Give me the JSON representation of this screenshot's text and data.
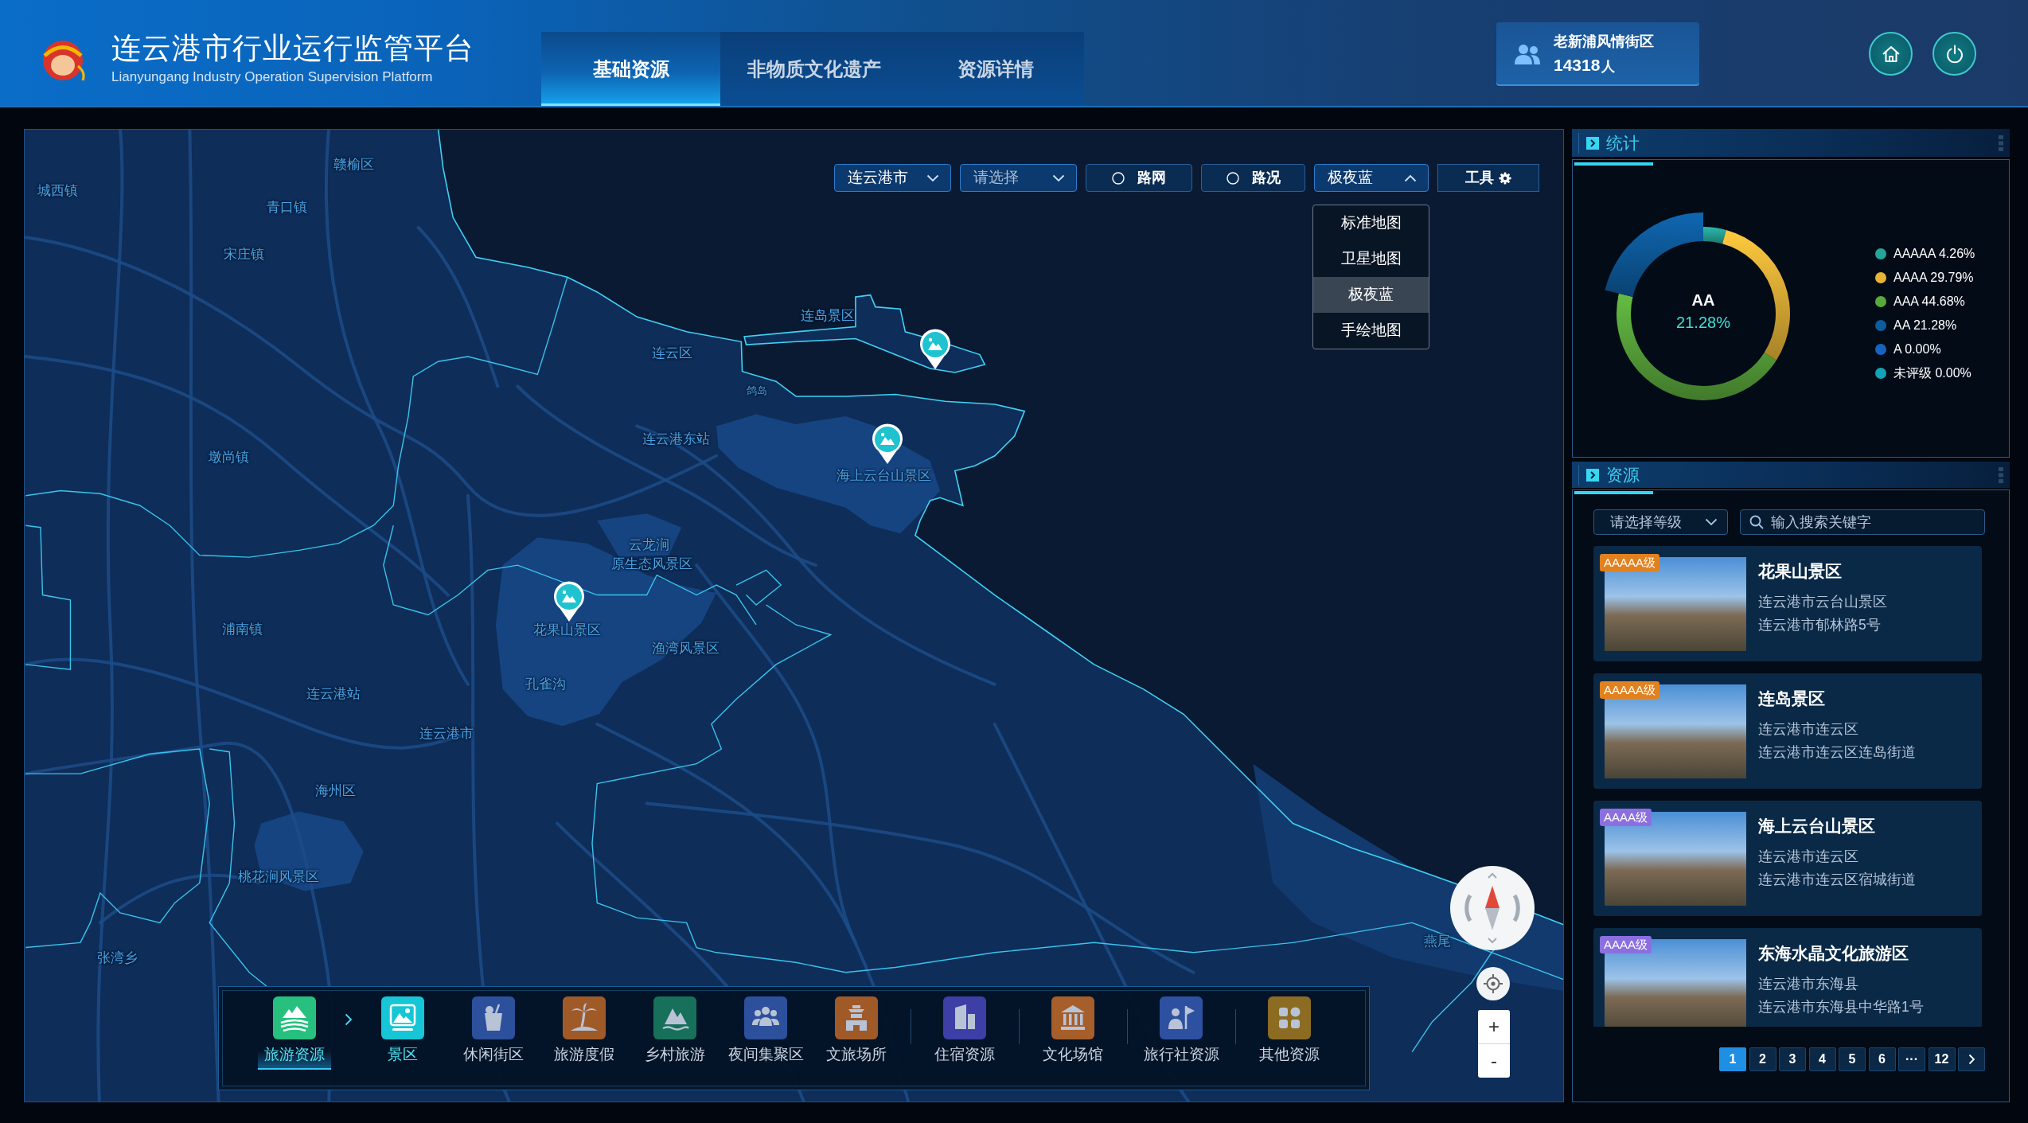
{
  "header": {
    "title": "连云港市行业运行监管平台",
    "subtitle": "Lianyungang Industry Operation Supervision Platform",
    "tabs": [
      {
        "label": "基础资源",
        "selected": true
      },
      {
        "label": "非物质文化遗产",
        "selected": false
      },
      {
        "label": "资源详情",
        "selected": false
      }
    ],
    "visitor": {
      "place": "老新浦风情街区",
      "count": "14318",
      "unit": "人"
    }
  },
  "map": {
    "controls": {
      "city_select": {
        "value": "连云港市"
      },
      "district_select": {
        "placeholder": "请选择"
      },
      "toggles": [
        {
          "label": "路网",
          "checked": false
        },
        {
          "label": "路况",
          "checked": false
        }
      ],
      "basemap_select": {
        "value": "极夜蓝",
        "expanded": true,
        "options": [
          {
            "label": "标准地图",
            "selected": false
          },
          {
            "label": "卫星地图",
            "selected": false
          },
          {
            "label": "极夜蓝",
            "selected": true
          },
          {
            "label": "手绘地图",
            "selected": false
          }
        ]
      },
      "tools_button": {
        "label": "工具"
      }
    },
    "place_labels": [
      "赣榆区",
      "城西镇",
      "青口镇",
      "宋庄镇",
      "连岛景区",
      "连云区",
      "鸽岛",
      "连云港东站",
      "墩尚镇",
      "海上云台山景区",
      "云龙涧",
      "原生态风景区",
      "花果山景区",
      "浦南镇",
      "渔湾风景区",
      "孔雀沟",
      "连云港站",
      "连云港市",
      "海州区",
      "桃花涧风景区",
      "燕尾",
      "张湾乡"
    ],
    "zoom": {
      "zoom_in": "+",
      "zoom_out": "-"
    }
  },
  "toolbar": {
    "items": [
      {
        "label": "旅游资源",
        "kind": "category",
        "selected": true,
        "color": "#27c07f"
      },
      {
        "label": "景区",
        "kind": "subtype",
        "selected": true,
        "color": "#16c6d6"
      },
      {
        "label": "休闲街区",
        "kind": "subtype",
        "selected": false,
        "color": "#2d509c"
      },
      {
        "label": "旅游度假",
        "kind": "subtype",
        "selected": false,
        "color": "#a05a28"
      },
      {
        "label": "乡村旅游",
        "kind": "subtype",
        "selected": false,
        "color": "#17705a"
      },
      {
        "label": "夜间集聚区",
        "kind": "subtype",
        "selected": false,
        "color": "#2d509c"
      },
      {
        "label": "文旅场所",
        "kind": "subtype",
        "selected": false,
        "color": "#a05a28"
      },
      {
        "label": "住宿资源",
        "kind": "group",
        "selected": false,
        "color": "#3d3fa6"
      },
      {
        "label": "文化场馆",
        "kind": "group",
        "selected": false,
        "color": "#a65e2a"
      },
      {
        "label": "旅行社资源",
        "kind": "group",
        "selected": false,
        "color": "#2d50a0"
      },
      {
        "label": "其他资源",
        "kind": "group",
        "selected": false,
        "color": "#8c6c22"
      }
    ]
  },
  "stats": {
    "title": "统计",
    "chart_data": {
      "type": "donut",
      "values": [
        4.26,
        29.79,
        44.68,
        21.28,
        0,
        0
      ]
    },
    "legend": [
      {
        "text": "AAAAA 4.26%",
        "color": "#26a69a",
        "selected": false
      },
      {
        "text": "AAAA 29.79%",
        "color": "#e6b437",
        "selected": false
      },
      {
        "text": "AAA 44.68%",
        "color": "#5aa83c",
        "selected": false
      },
      {
        "text": "AA 21.28%",
        "color": "#0d5c9e",
        "selected": true,
        "center_label": "AA",
        "center_value": "21.28%"
      },
      {
        "text": "A 0.00%",
        "color": "#1565c0"
      },
      {
        "text": "未评级 0.00%",
        "color": "#13a3b5"
      }
    ]
  },
  "resources": {
    "title": "资源",
    "grade_select": {
      "placeholder": "请选择等级"
    },
    "search": {
      "placeholder": "输入搜索关键字"
    },
    "cards": [
      {
        "badge": "AAAAA级",
        "color": "#e2811e",
        "name": "花果山景区",
        "district": "连云港市云台山景区",
        "address": "连云港市郁林路5号"
      },
      {
        "badge": "AAAAA级",
        "color": "#e2811e",
        "name": "连岛景区",
        "district": "连云港市连云区",
        "address": "连云港市连云区连岛街道"
      },
      {
        "badge": "AAAA级",
        "color": "#8b6fe0",
        "name": "海上云台山景区",
        "district": "连云港市连云区",
        "address": "连云港市连云区宿城街道"
      },
      {
        "badge": "AAAA级",
        "color": "#8b6fe0",
        "name": "东海水晶文化旅游区",
        "district": "连云港市东海县",
        "address": "连云港市东海县中华路1号"
      }
    ],
    "pagination": {
      "pages": [
        {
          "label": "1",
          "selected": true
        },
        {
          "label": "2",
          "selected": false
        },
        {
          "label": "3",
          "selected": false
        },
        {
          "label": "4",
          "selected": false
        },
        {
          "label": "5",
          "selected": false
        },
        {
          "label": "6",
          "selected": false
        }
      ],
      "ellipsis": "···",
      "last_pages": [
        {
          "label": "12",
          "selected": false
        }
      ]
    }
  }
}
